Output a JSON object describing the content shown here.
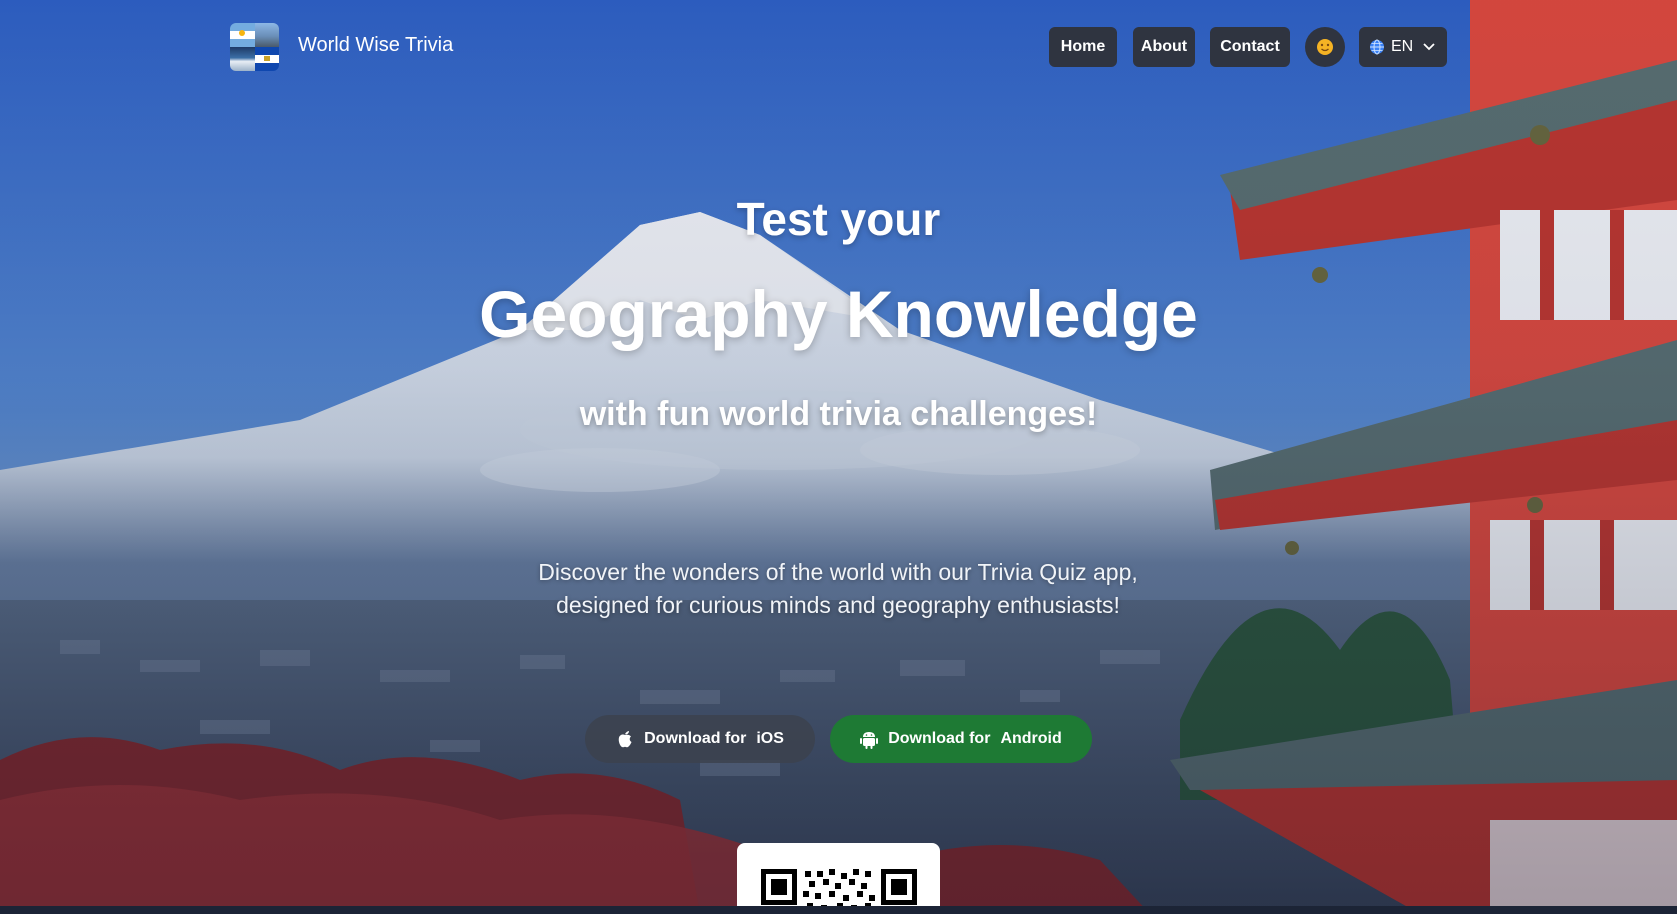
{
  "header": {
    "brand_name": "World Wise Trivia",
    "nav": {
      "home": "Home",
      "about": "About",
      "contact": "Contact"
    },
    "theme_icon": "sun-face-icon",
    "language": {
      "icon": "globe-icon",
      "selected": "EN"
    }
  },
  "hero": {
    "line1": "Test your",
    "line2": "Geography Knowledge",
    "line3": "with fun world trivia challenges!",
    "description_line1": "Discover the wonders of the world with our Trivia Quiz app,",
    "description_line2": "designed for curious minds and geography enthusiasts!"
  },
  "downloads": {
    "ios": {
      "prefix": "Download for",
      "platform": "iOS",
      "icon": "apple-icon"
    },
    "android": {
      "prefix": "Download for",
      "platform": "Android",
      "icon": "android-icon",
      "color": "#1e7a34"
    }
  },
  "qr": {
    "icon": "qr-code-icon"
  },
  "colors": {
    "nav_bg": "#2f3440",
    "android_green": "#1e7a34",
    "sky": "#3a6fc4"
  }
}
